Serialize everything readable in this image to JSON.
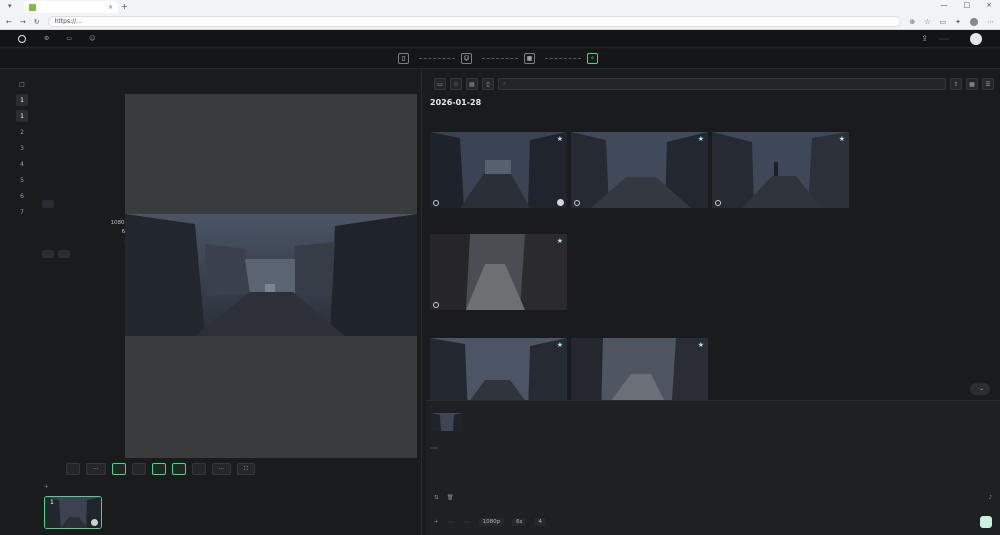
{
  "browser": {
    "tab_title": "",
    "address": "https://...",
    "tab_close": "×",
    "new_tab": "+",
    "window_controls": [
      "—",
      "□",
      "×"
    ]
  },
  "header": {
    "logo": "",
    "nav": [
      "",
      "",
      ""
    ],
    "credits": "",
    "user": ""
  },
  "steps": [
    {
      "label": "",
      "icon": "book-icon"
    },
    {
      "label": "",
      "icon": "person-icon"
    },
    {
      "label": "",
      "icon": "film-icon"
    },
    {
      "label": "",
      "icon": "magic-icon",
      "active": true
    }
  ],
  "left_nav": [
    "□",
    "1",
    "1",
    "2",
    "3",
    "4",
    "5",
    "6",
    "7"
  ],
  "left_panel": {
    "title": "",
    "meta": [
      {
        "k": "",
        "v": ""
      },
      {
        "k": "",
        "v": ""
      },
      {
        "k": "",
        "v": ""
      },
      {
        "k": "",
        "v": ""
      }
    ],
    "description": "",
    "specs": [
      {
        "k": "",
        "v": ""
      },
      {
        "k": "",
        "v": "1080p"
      },
      {
        "k": "",
        "v": "6s"
      },
      {
        "k": "",
        "v": "4"
      }
    ],
    "toolbar": [
      "",
      "⋯",
      "",
      "",
      "",
      "",
      "",
      "⋯",
      "⛶"
    ],
    "strip": [
      "+",
      "",
      ""
    ],
    "thumb_no": "1"
  },
  "right_panel": {
    "search_placeholder": "",
    "date": "2026-01-28",
    "prompts": [
      "",
      "",
      ""
    ],
    "back_top": "",
    "compose_chip": "",
    "compose_text": "",
    "ref_label": "",
    "bottom_left": [
      "",
      ""
    ],
    "bottom_right": [
      "",
      ""
    ],
    "controls": [
      "+",
      "",
      "",
      "1080p",
      "6s",
      "4"
    ],
    "generate": ""
  }
}
